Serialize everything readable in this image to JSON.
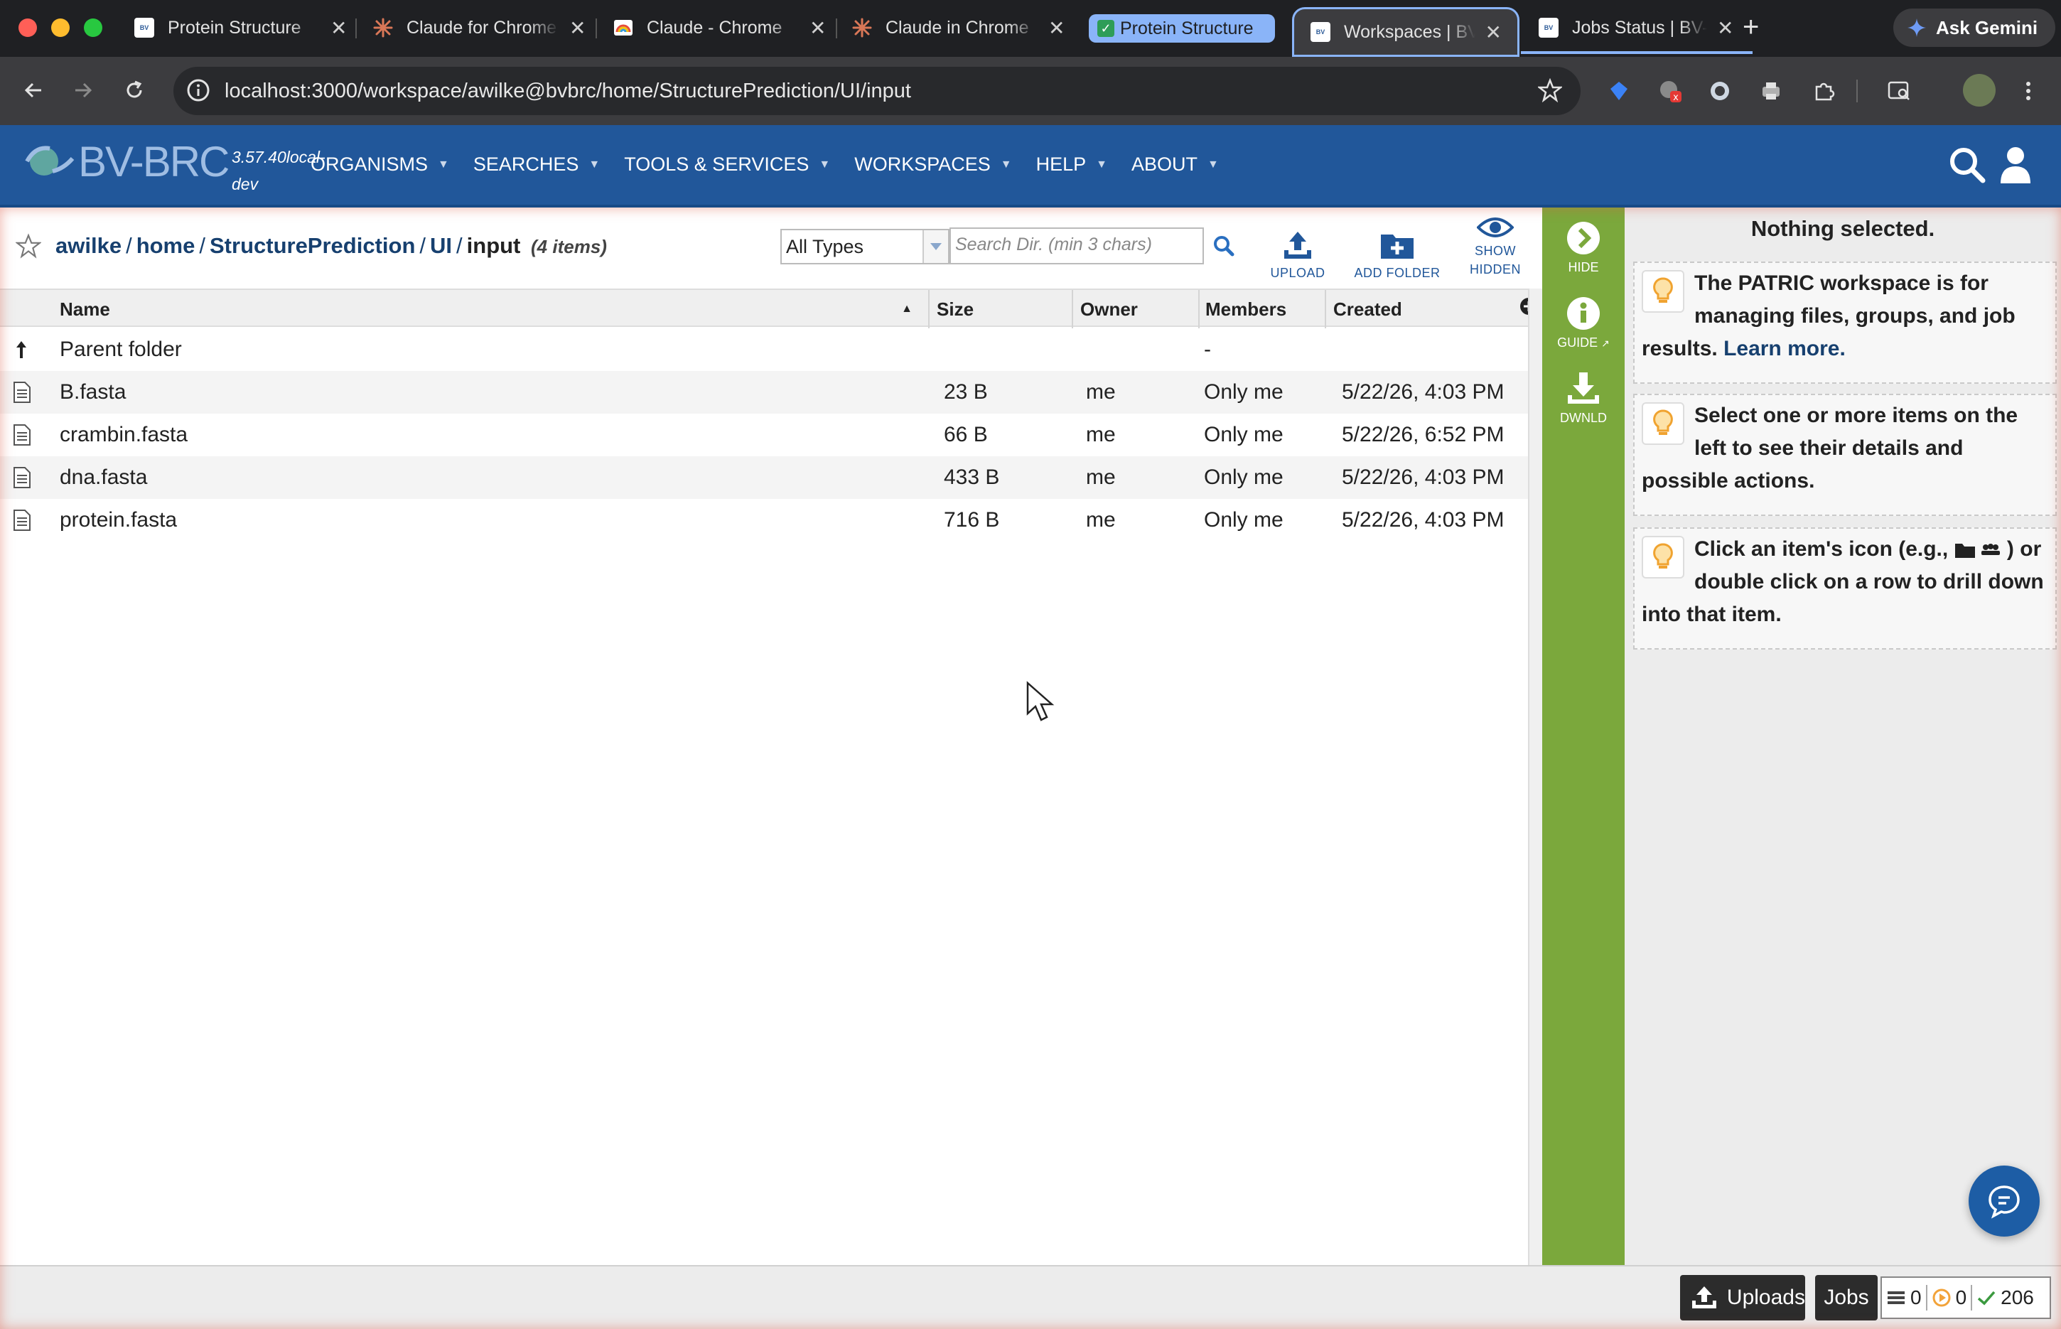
{
  "browser": {
    "tabs": [
      {
        "title": "Protein Structure",
        "favicon": "bvbrc-icon"
      },
      {
        "title": "Claude for Chrome",
        "favicon": "claude-icon"
      },
      {
        "title": "Claude - Chrome",
        "favicon": "rainbow-icon"
      },
      {
        "title": "Claude in Chrome",
        "favicon": "claude-icon"
      },
      {
        "title": "Protein Structure",
        "favicon": "check-icon",
        "group": true
      },
      {
        "title": "Workspaces | BV-BRC",
        "favicon": "bvbrc-icon",
        "active": true
      },
      {
        "title": "Jobs Status | BV-BRC",
        "favicon": "bvbrc-icon"
      }
    ],
    "close_glyph": "✕",
    "new_tab": "+",
    "gemini_label": "Ask Gemini",
    "url": "localhost:3000/workspace/awilke@bvbrc/home/StructurePrediction/UI/input"
  },
  "app": {
    "logo_text": "BV-BRC",
    "version": "3.57.40local-dev",
    "menu": [
      "ORGANISMS",
      "SEARCHES",
      "TOOLS & SERVICES",
      "WORKSPACES",
      "HELP",
      "ABOUT"
    ]
  },
  "workspace": {
    "breadcrumb": [
      "awilke",
      "home",
      "StructurePrediction",
      "UI",
      "input"
    ],
    "item_count": "(4 items)",
    "type_filter": "All Types",
    "search_placeholder": "Search Dir. (min 3 chars)",
    "actions": {
      "upload": "UPLOAD",
      "add_folder": "ADD FOLDER",
      "show_hidden_1": "SHOW",
      "show_hidden_2": "HIDDEN"
    },
    "columns": {
      "name": "Name",
      "size": "Size",
      "owner": "Owner",
      "members": "Members",
      "created": "Created"
    },
    "parent_row": {
      "name": "Parent folder",
      "members": "-"
    },
    "rows": [
      {
        "name": "B.fasta",
        "size": "23 B",
        "owner": "me",
        "members": "Only me",
        "created": "5/22/26, 4:03 PM"
      },
      {
        "name": "crambin.fasta",
        "size": "66 B",
        "owner": "me",
        "members": "Only me",
        "created": "5/22/26, 6:52 PM"
      },
      {
        "name": "dna.fasta",
        "size": "433 B",
        "owner": "me",
        "members": "Only me",
        "created": "5/22/26, 4:03 PM"
      },
      {
        "name": "protein.fasta",
        "size": "716 B",
        "owner": "me",
        "members": "Only me",
        "created": "5/22/26, 4:03 PM"
      }
    ]
  },
  "sidebar_actions": {
    "hide": "HIDE",
    "guide": "GUIDE",
    "download": "DWNLD"
  },
  "panel": {
    "title": "Nothing selected.",
    "tip1": "The PATRIC workspace is for managing files, groups, and job results.",
    "tip1_link": "Learn more.",
    "tip2": "Select one or more items on the left to see their details and possible actions.",
    "tip3_a": "Click an item's icon (e.g.,",
    "tip3_b": ") or double click on a row to drill down into that item."
  },
  "status": {
    "uploads": "Uploads",
    "jobs": "Jobs",
    "queued": "0",
    "running": "0",
    "completed": "206"
  },
  "colors": {
    "header": "#21579a",
    "green_bar": "#7ba83c",
    "link": "#17406f"
  }
}
